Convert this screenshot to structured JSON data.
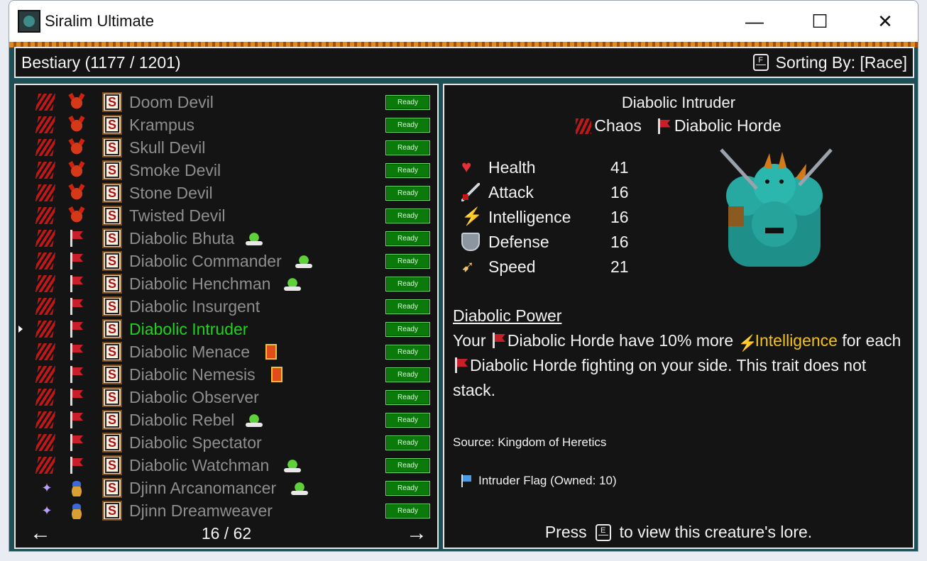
{
  "window": {
    "title": "Siralim Ultimate",
    "minimize": "—",
    "maximize": "☐",
    "close": "✕"
  },
  "header": {
    "title": "Bestiary (1177 / 1201)",
    "sort_key": "F",
    "sort_label": "Sorting By: [Race]"
  },
  "list": {
    "ready_label": "Ready",
    "rows": [
      {
        "name": "Doom Devil",
        "class": "chaos",
        "race": "devil",
        "badge": ""
      },
      {
        "name": "Krampus",
        "class": "chaos",
        "race": "devil",
        "badge": ""
      },
      {
        "name": "Skull Devil",
        "class": "chaos",
        "race": "devil",
        "badge": ""
      },
      {
        "name": "Smoke Devil",
        "class": "chaos",
        "race": "devil",
        "badge": ""
      },
      {
        "name": "Stone Devil",
        "class": "chaos",
        "race": "devil",
        "badge": ""
      },
      {
        "name": "Twisted Devil",
        "class": "chaos",
        "race": "devil",
        "badge": ""
      },
      {
        "name": "Diabolic Bhuta",
        "class": "chaos",
        "race": "horde",
        "badge": "goblin"
      },
      {
        "name": "Diabolic Commander",
        "class": "chaos",
        "race": "horde",
        "badge": "goblin"
      },
      {
        "name": "Diabolic Henchman",
        "class": "chaos",
        "race": "horde",
        "badge": "goblin"
      },
      {
        "name": "Diabolic Insurgent",
        "class": "chaos",
        "race": "horde",
        "badge": ""
      },
      {
        "name": "Diabolic Intruder",
        "class": "chaos",
        "race": "horde",
        "badge": "",
        "selected": true
      },
      {
        "name": "Diabolic Menace",
        "class": "chaos",
        "race": "horde",
        "badge": "card"
      },
      {
        "name": "Diabolic Nemesis",
        "class": "chaos",
        "race": "horde",
        "badge": "card"
      },
      {
        "name": "Diabolic Observer",
        "class": "chaos",
        "race": "horde",
        "badge": ""
      },
      {
        "name": "Diabolic Rebel",
        "class": "chaos",
        "race": "horde",
        "badge": "goblin"
      },
      {
        "name": "Diabolic Spectator",
        "class": "chaos",
        "race": "horde",
        "badge": ""
      },
      {
        "name": "Diabolic Watchman",
        "class": "chaos",
        "race": "horde",
        "badge": "goblin"
      },
      {
        "name": "Djinn Arcanomancer",
        "class": "sorcery",
        "race": "lamp",
        "badge": "goblin"
      },
      {
        "name": "Djinn Dreamweaver",
        "class": "sorcery",
        "race": "lamp",
        "badge": ""
      }
    ],
    "page": "16 / 62",
    "prev_arrow": "←",
    "next_arrow": "→"
  },
  "detail": {
    "name": "Diabolic Intruder",
    "class": "Chaos",
    "race": "Diabolic Horde",
    "stats": [
      {
        "label": "Health",
        "value": "41",
        "icon": "heart-icon"
      },
      {
        "label": "Attack",
        "value": "16",
        "icon": "sword-icon"
      },
      {
        "label": "Intelligence",
        "value": "16",
        "icon": "lightning-icon"
      },
      {
        "label": "Defense",
        "value": "16",
        "icon": "shield-icon"
      },
      {
        "label": "Speed",
        "value": "21",
        "icon": "wing-icon"
      }
    ],
    "trait_title": "Diabolic Power",
    "trait": {
      "p1": "Your ",
      "race1": "Diabolic Horde",
      "p2": " have 10% more ",
      "stat": "Intelligence",
      "p3": " for each ",
      "race2": "Diabolic Horde",
      "p4": " fighting on your side. This trait does not stack."
    },
    "source": "Source: Kingdom of Heretics",
    "item": "Intruder Flag (Owned: 10)",
    "lore_pre": "Press",
    "lore_key": "E",
    "lore_post": "to view this creature's lore."
  },
  "colors": {
    "selected": "#1fd21f",
    "ready_bg": "#0a7a0a",
    "highlight": "#f3c21b",
    "chaos": "#c01818"
  }
}
